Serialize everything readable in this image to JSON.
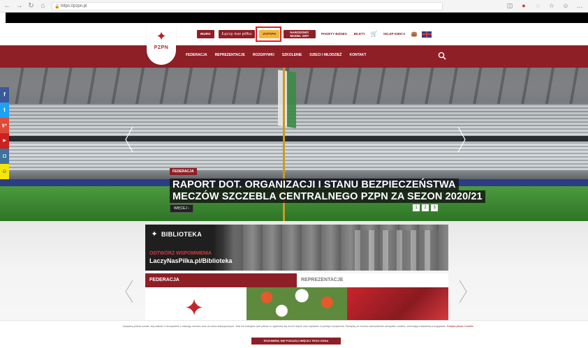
{
  "browser": {
    "url": "https://pzpn.pl",
    "back_icon": "arrow-left-icon",
    "forward_icon": "arrow-right-icon",
    "refresh_icon": "refresh-icon",
    "home_icon": "home-icon"
  },
  "header": {
    "logo_text": "PZPN",
    "top_links": [
      {
        "label": "BIURO",
        "style": "dark"
      },
      {
        "label": "Łączy nas piłka",
        "style": "script"
      },
      {
        "label": "ZOPSPN",
        "style": "gold"
      },
      {
        "label": "NARODOWY MODEL GRY PZPN",
        "style": "multi"
      },
      {
        "label": "PAKIETY BIZNES",
        "style": "plain"
      },
      {
        "label": "BILETY",
        "style": "plain"
      },
      {
        "label": "SKLEP KIBICA",
        "style": "plain"
      }
    ],
    "nav": [
      "FEDERACJA",
      "REPREZENTACJE",
      "ROZGRYWKI",
      "SZKOLENIE",
      "DZIECI I MŁODZIEŻ",
      "KONTAKT"
    ]
  },
  "hero": {
    "tag": "FEDERACJA",
    "headline_line1": "RAPORT DOT. ORGANIZACJI I STANU BEZPIECZEŃSTWA",
    "headline_line2": "MECZÓW SZCZEBLA CENTRALNEGO PZPN ZA SEZON 2020/21",
    "more_label": "WIĘCEJ",
    "pages": [
      "1",
      "2",
      "3"
    ]
  },
  "social": [
    {
      "icon": "facebook-icon",
      "glyph": "f",
      "color": "#3b5998"
    },
    {
      "icon": "twitter-icon",
      "glyph": "t",
      "color": "#1da1f2"
    },
    {
      "icon": "google-plus-icon",
      "glyph": "g+",
      "color": "#dd4b39"
    },
    {
      "icon": "youtube-icon",
      "glyph": "▶",
      "color": "#cd201f"
    },
    {
      "icon": "instagram-icon",
      "glyph": "◘",
      "color": "#3f729b"
    },
    {
      "icon": "snapchat-icon",
      "glyph": "☺",
      "color": "#f5e50b"
    }
  ],
  "biblioteka": {
    "word": "BIBLIOTEKA",
    "cta": "ODTWÓRZ WSPOMNIENIA",
    "url": "LaczyNasPilka.pl/Biblioteka"
  },
  "tabs": [
    {
      "label": "FEDERACJA",
      "active": true
    },
    {
      "label": "REPREZENTACJE",
      "active": false
    }
  ],
  "cookie": {
    "text": "Używamy plików cookie, aby ułatwić Ci korzystanie z naszego serwisu oraz do celów statystycznych. Jeśli nie blokujesz tych plików, to zgadzasz się na ich użycie oraz zapisanie w pamięci urządzenia. Pamiętaj, że możesz samodzielnie zarządzać cookies, zmieniając ustawienia przeglądarki.",
    "link": "Polityka plików Cookies.",
    "button": "ROZUMIEM, NIE POKAZUJ WIĘCEJ TEGO OKNA"
  }
}
